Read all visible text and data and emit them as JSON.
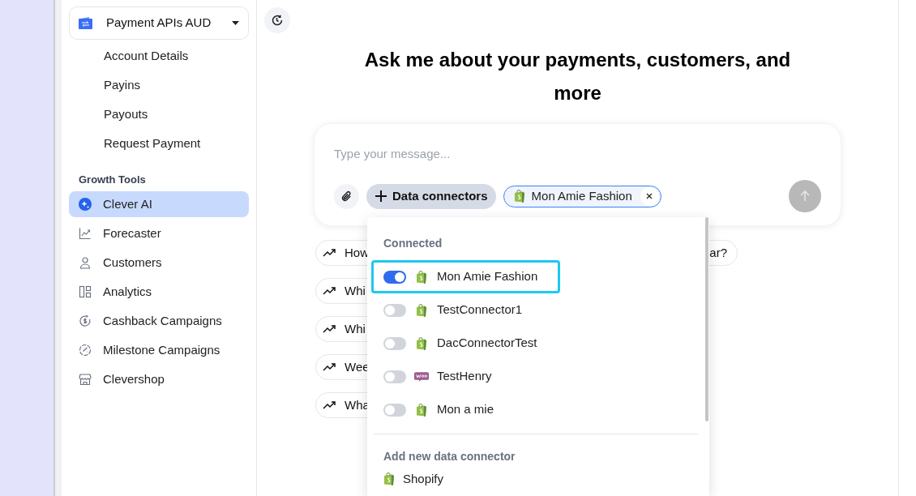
{
  "sidebar": {
    "account": {
      "label": "Payment APIs AUD"
    },
    "account_items": [
      {
        "label": "Account Details"
      },
      {
        "label": "Payins"
      },
      {
        "label": "Payouts"
      },
      {
        "label": "Request Payment"
      }
    ],
    "section": "Growth Tools",
    "items": [
      {
        "label": "Clever AI",
        "selected": true
      },
      {
        "label": "Forecaster",
        "selected": false
      },
      {
        "label": "Customers",
        "selected": false
      },
      {
        "label": "Analytics",
        "selected": false
      },
      {
        "label": "Cashback Campaigns",
        "selected": false
      },
      {
        "label": "Milestone Campaigns",
        "selected": false
      },
      {
        "label": "Clevershop",
        "selected": false
      }
    ]
  },
  "main": {
    "title": "Ask me about your payments, customers, and more",
    "composer": {
      "placeholder": "Type your message...",
      "connectors_button": "Data connectors",
      "chips": [
        {
          "label": "Mon Amie Fashion",
          "kind": "shopify"
        }
      ]
    },
    "suggestions": [
      {
        "start": "How",
        "end": "ar?"
      },
      {
        "start": "Whi"
      },
      {
        "start": "Whi"
      },
      {
        "start": "Wee"
      },
      {
        "start": "Wha"
      }
    ],
    "dropdown": {
      "connected_heading": "Connected",
      "connectors": [
        {
          "label": "Mon Amie Fashion",
          "kind": "shopify",
          "on": true,
          "highlighted": true
        },
        {
          "label": "TestConnector1",
          "kind": "shopify",
          "on": false,
          "highlighted": false
        },
        {
          "label": "DacConnectorTest",
          "kind": "shopify",
          "on": false,
          "highlighted": false
        },
        {
          "label": "TestHenry",
          "kind": "woo",
          "on": false,
          "highlighted": false
        },
        {
          "label": "Mon a mie",
          "kind": "shopify",
          "on": false,
          "highlighted": false
        }
      ],
      "add_heading": "Add new data connector",
      "add_items": [
        {
          "label": "Shopify",
          "kind": "shopify"
        }
      ]
    }
  }
}
